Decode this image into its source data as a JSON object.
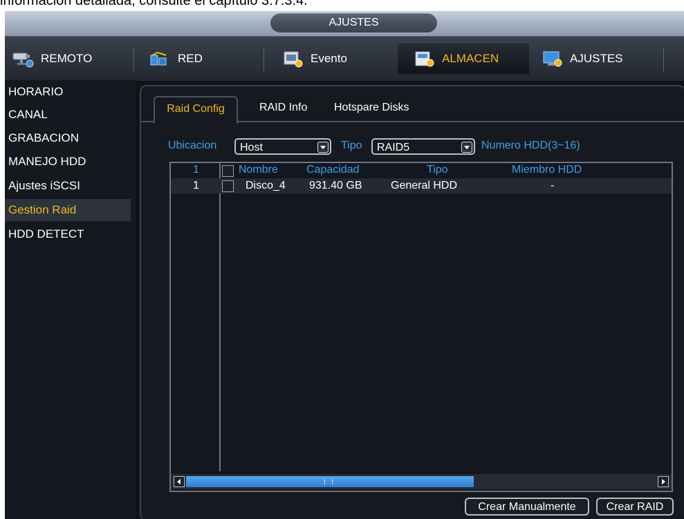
{
  "document_caption": "información detallada, consulte el capítulo 3.7.3.4.",
  "window": {
    "title": "AJUSTES",
    "main_tabs": [
      {
        "label": "REMOTO",
        "icon": "camera-icon"
      },
      {
        "label": "RED",
        "icon": "network-icon"
      },
      {
        "label": "Evento",
        "icon": "event-icon"
      },
      {
        "label": "ALMACEN",
        "icon": "storage-icon",
        "active": true
      },
      {
        "label": "AJUSTES",
        "icon": "settings-icon"
      }
    ]
  },
  "sidebar": {
    "items": [
      {
        "label": "HORARIO"
      },
      {
        "label": "CANAL"
      },
      {
        "label": "GRABACION"
      },
      {
        "label": "MANEJO HDD"
      },
      {
        "label": "Ajustes iSCSI"
      },
      {
        "label": "Gestion Raid",
        "active": true
      },
      {
        "label": "HDD DETECT"
      }
    ]
  },
  "subtabs": [
    {
      "label": "Raid Config",
      "active": true
    },
    {
      "label": "RAID Info"
    },
    {
      "label": "Hotspare Disks"
    }
  ],
  "form": {
    "location_label": "Ubicacion",
    "location_value": "Host",
    "type_label": "Tipo",
    "type_value": "RAID5",
    "hdd_count_label": "Numero HDD(3~16)"
  },
  "table": {
    "headers": {
      "index": "1",
      "name": "Nombre",
      "capacity": "Capacidad",
      "type": "Tipo",
      "member": "Miembro HDD"
    },
    "rows": [
      {
        "index": "1",
        "name": "Disco_4",
        "capacity": "931.40 GB",
        "type": "General HDD",
        "member": "-"
      }
    ]
  },
  "buttons": {
    "create_manual": "Crear Manualmente",
    "create_raid": "Crear RAID"
  },
  "colors": {
    "accent": "#f0b71d",
    "label_blue": "#3ea0e6",
    "background": "#101217"
  }
}
